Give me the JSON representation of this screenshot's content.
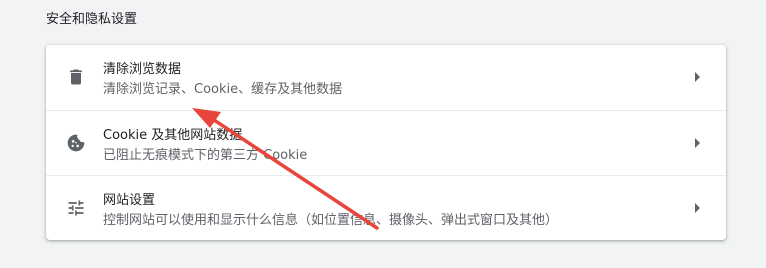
{
  "section": {
    "title": "安全和隐私设置"
  },
  "rows": [
    {
      "title": "清除浏览数据",
      "subtitle": "清除浏览记录、Cookie、缓存及其他数据",
      "icon": "trash-icon"
    },
    {
      "title": "Cookie 及其他网站数据",
      "subtitle": "已阻止无痕模式下的第三方 Cookie",
      "icon": "cookie-icon"
    },
    {
      "title": "网站设置",
      "subtitle": "控制网站可以使用和显示什么信息（如位置信息、摄像头、弹出式窗口及其他）",
      "icon": "tune-icon"
    }
  ],
  "colors": {
    "annotation_arrow": "#e8453c",
    "icon": "#5f6368",
    "background": "#f1f3f4"
  }
}
